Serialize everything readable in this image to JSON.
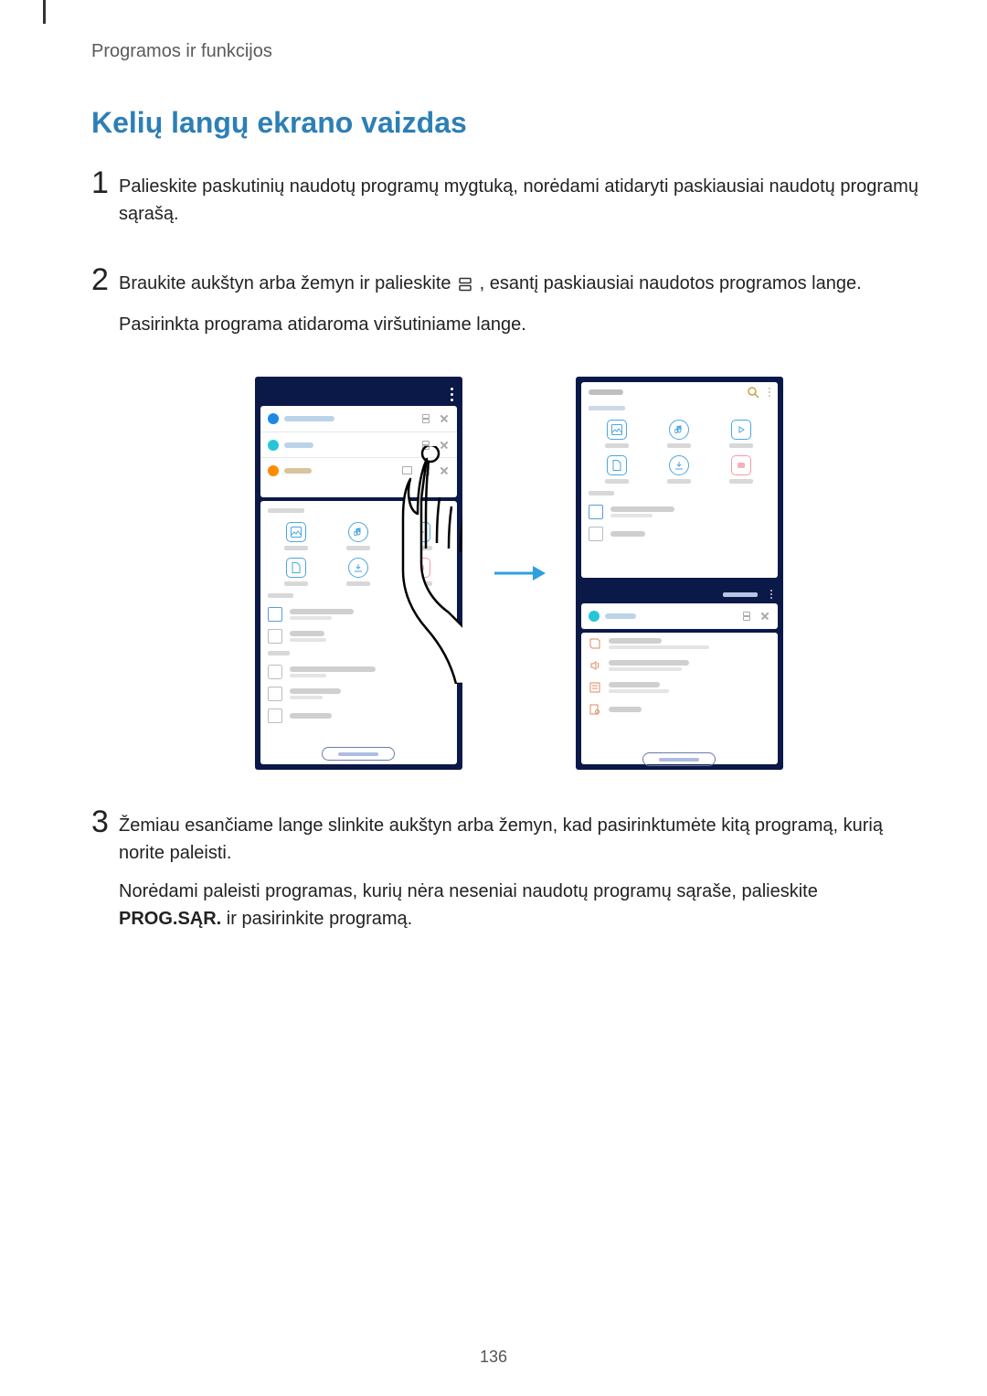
{
  "header": {
    "breadcrumb": "Programos ir funkcijos"
  },
  "section": {
    "title": "Kelių langų ekrano vaizdas"
  },
  "steps": {
    "s1": {
      "num": "1",
      "text": "Palieskite paskutinių naudotų programų mygtuką, norėdami atidaryti paskiausiai naudotų programų sąrašą."
    },
    "s2": {
      "num": "2",
      "line1_pre": "Braukite aukštyn arba žemyn ir palieskite ",
      "line1_post": ", esantį paskiausiai naudotos programos lange.",
      "line2": "Pasirinkta programa atidaroma viršutiniame lange."
    },
    "s3": {
      "num": "3",
      "p1": "Žemiau esančiame lange slinkite aukštyn arba žemyn, kad pasirinktumėte kitą programą, kurią norite paleisti.",
      "p2_pre": "Norėdami paleisti programas, kurių nėra neseniai naudotų programų sąraše, palieskite ",
      "p2_bold": "PROG.SĄR.",
      "p2_post": " ir pasirinkite programą."
    }
  },
  "page_number": "136"
}
